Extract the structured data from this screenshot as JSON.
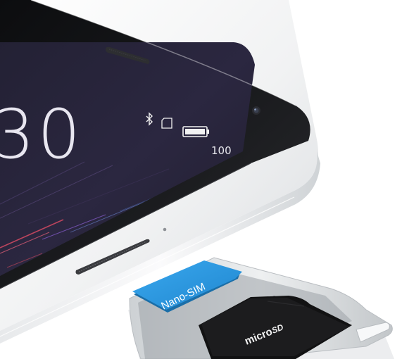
{
  "image": {
    "subject": "phone-with-sim-card-tray",
    "colors": {
      "body": "#f4f5f6",
      "bezel": "#141517",
      "screen": "#262338",
      "sim_card": "#2b9be3",
      "microsd_card": "#151515"
    }
  },
  "phone_screen": {
    "clock_partial": "30",
    "battery_percent": "100",
    "status_icons": [
      "bluetooth-icon",
      "sim-icon",
      "battery-icon"
    ]
  },
  "sim_tray": {
    "sim_label": "Nano-SIM",
    "sd_brand_top": "micro",
    "sd_brand_bottom": "SD"
  }
}
